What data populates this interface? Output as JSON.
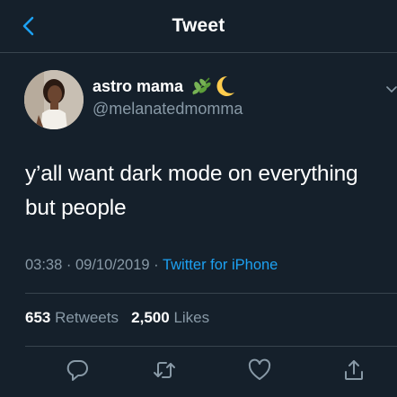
{
  "header": {
    "title": "Tweet",
    "back_icon": "chevron-left-icon"
  },
  "author": {
    "display_name": "astro mama",
    "name_emojis": [
      "herb-icon",
      "crescent-moon-icon"
    ],
    "handle": "@melanatedmomma"
  },
  "tweet": {
    "text_line1": "y’all want dark mode on everything",
    "text_line2": "but people",
    "time": "03:38",
    "date": "09/10/2019",
    "separator": "·",
    "source": "Twitter for iPhone"
  },
  "stats": {
    "retweets_count": "653",
    "retweets_label": "Retweets",
    "likes_count": "2,500",
    "likes_label": "Likes"
  },
  "actions": [
    "reply-icon",
    "retweet-icon",
    "like-icon",
    "share-icon"
  ],
  "colors": {
    "background": "#15202b",
    "accent": "#1da1f2",
    "secondary_text": "#8899a6",
    "divider": "#38444d"
  }
}
